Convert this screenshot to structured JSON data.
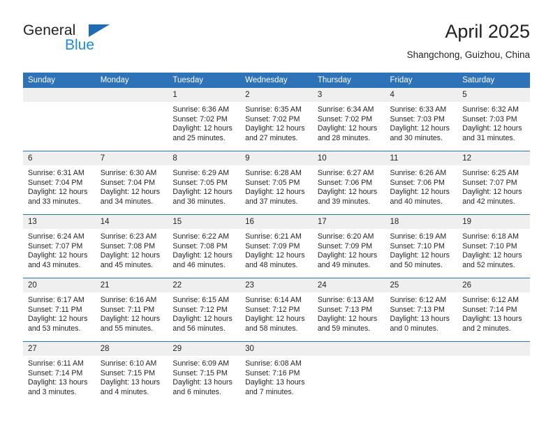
{
  "brand": {
    "name_part1": "General",
    "name_part2": "Blue",
    "accent_blue": "#1f8ad6",
    "logo_triangle_color": "#1f6cb4"
  },
  "header": {
    "title": "April 2025",
    "location": "Shangchong, Guizhou, China"
  },
  "calendar": {
    "header_color": "#2e72b8",
    "daynum_strip_color": "#efefef",
    "weekday_headers": [
      "Sunday",
      "Monday",
      "Tuesday",
      "Wednesday",
      "Thursday",
      "Friday",
      "Saturday"
    ],
    "weeks": [
      [
        {
          "day": "",
          "sunrise": "",
          "sunset": "",
          "daylight_line1": "",
          "daylight_line2": ""
        },
        {
          "day": "",
          "sunrise": "",
          "sunset": "",
          "daylight_line1": "",
          "daylight_line2": ""
        },
        {
          "day": "1",
          "sunrise": "Sunrise: 6:36 AM",
          "sunset": "Sunset: 7:02 PM",
          "daylight_line1": "Daylight: 12 hours",
          "daylight_line2": "and 25 minutes."
        },
        {
          "day": "2",
          "sunrise": "Sunrise: 6:35 AM",
          "sunset": "Sunset: 7:02 PM",
          "daylight_line1": "Daylight: 12 hours",
          "daylight_line2": "and 27 minutes."
        },
        {
          "day": "3",
          "sunrise": "Sunrise: 6:34 AM",
          "sunset": "Sunset: 7:02 PM",
          "daylight_line1": "Daylight: 12 hours",
          "daylight_line2": "and 28 minutes."
        },
        {
          "day": "4",
          "sunrise": "Sunrise: 6:33 AM",
          "sunset": "Sunset: 7:03 PM",
          "daylight_line1": "Daylight: 12 hours",
          "daylight_line2": "and 30 minutes."
        },
        {
          "day": "5",
          "sunrise": "Sunrise: 6:32 AM",
          "sunset": "Sunset: 7:03 PM",
          "daylight_line1": "Daylight: 12 hours",
          "daylight_line2": "and 31 minutes."
        }
      ],
      [
        {
          "day": "6",
          "sunrise": "Sunrise: 6:31 AM",
          "sunset": "Sunset: 7:04 PM",
          "daylight_line1": "Daylight: 12 hours",
          "daylight_line2": "and 33 minutes."
        },
        {
          "day": "7",
          "sunrise": "Sunrise: 6:30 AM",
          "sunset": "Sunset: 7:04 PM",
          "daylight_line1": "Daylight: 12 hours",
          "daylight_line2": "and 34 minutes."
        },
        {
          "day": "8",
          "sunrise": "Sunrise: 6:29 AM",
          "sunset": "Sunset: 7:05 PM",
          "daylight_line1": "Daylight: 12 hours",
          "daylight_line2": "and 36 minutes."
        },
        {
          "day": "9",
          "sunrise": "Sunrise: 6:28 AM",
          "sunset": "Sunset: 7:05 PM",
          "daylight_line1": "Daylight: 12 hours",
          "daylight_line2": "and 37 minutes."
        },
        {
          "day": "10",
          "sunrise": "Sunrise: 6:27 AM",
          "sunset": "Sunset: 7:06 PM",
          "daylight_line1": "Daylight: 12 hours",
          "daylight_line2": "and 39 minutes."
        },
        {
          "day": "11",
          "sunrise": "Sunrise: 6:26 AM",
          "sunset": "Sunset: 7:06 PM",
          "daylight_line1": "Daylight: 12 hours",
          "daylight_line2": "and 40 minutes."
        },
        {
          "day": "12",
          "sunrise": "Sunrise: 6:25 AM",
          "sunset": "Sunset: 7:07 PM",
          "daylight_line1": "Daylight: 12 hours",
          "daylight_line2": "and 42 minutes."
        }
      ],
      [
        {
          "day": "13",
          "sunrise": "Sunrise: 6:24 AM",
          "sunset": "Sunset: 7:07 PM",
          "daylight_line1": "Daylight: 12 hours",
          "daylight_line2": "and 43 minutes."
        },
        {
          "day": "14",
          "sunrise": "Sunrise: 6:23 AM",
          "sunset": "Sunset: 7:08 PM",
          "daylight_line1": "Daylight: 12 hours",
          "daylight_line2": "and 45 minutes."
        },
        {
          "day": "15",
          "sunrise": "Sunrise: 6:22 AM",
          "sunset": "Sunset: 7:08 PM",
          "daylight_line1": "Daylight: 12 hours",
          "daylight_line2": "and 46 minutes."
        },
        {
          "day": "16",
          "sunrise": "Sunrise: 6:21 AM",
          "sunset": "Sunset: 7:09 PM",
          "daylight_line1": "Daylight: 12 hours",
          "daylight_line2": "and 48 minutes."
        },
        {
          "day": "17",
          "sunrise": "Sunrise: 6:20 AM",
          "sunset": "Sunset: 7:09 PM",
          "daylight_line1": "Daylight: 12 hours",
          "daylight_line2": "and 49 minutes."
        },
        {
          "day": "18",
          "sunrise": "Sunrise: 6:19 AM",
          "sunset": "Sunset: 7:10 PM",
          "daylight_line1": "Daylight: 12 hours",
          "daylight_line2": "and 50 minutes."
        },
        {
          "day": "19",
          "sunrise": "Sunrise: 6:18 AM",
          "sunset": "Sunset: 7:10 PM",
          "daylight_line1": "Daylight: 12 hours",
          "daylight_line2": "and 52 minutes."
        }
      ],
      [
        {
          "day": "20",
          "sunrise": "Sunrise: 6:17 AM",
          "sunset": "Sunset: 7:11 PM",
          "daylight_line1": "Daylight: 12 hours",
          "daylight_line2": "and 53 minutes."
        },
        {
          "day": "21",
          "sunrise": "Sunrise: 6:16 AM",
          "sunset": "Sunset: 7:11 PM",
          "daylight_line1": "Daylight: 12 hours",
          "daylight_line2": "and 55 minutes."
        },
        {
          "day": "22",
          "sunrise": "Sunrise: 6:15 AM",
          "sunset": "Sunset: 7:12 PM",
          "daylight_line1": "Daylight: 12 hours",
          "daylight_line2": "and 56 minutes."
        },
        {
          "day": "23",
          "sunrise": "Sunrise: 6:14 AM",
          "sunset": "Sunset: 7:12 PM",
          "daylight_line1": "Daylight: 12 hours",
          "daylight_line2": "and 58 minutes."
        },
        {
          "day": "24",
          "sunrise": "Sunrise: 6:13 AM",
          "sunset": "Sunset: 7:13 PM",
          "daylight_line1": "Daylight: 12 hours",
          "daylight_line2": "and 59 minutes."
        },
        {
          "day": "25",
          "sunrise": "Sunrise: 6:12 AM",
          "sunset": "Sunset: 7:13 PM",
          "daylight_line1": "Daylight: 13 hours",
          "daylight_line2": "and 0 minutes."
        },
        {
          "day": "26",
          "sunrise": "Sunrise: 6:12 AM",
          "sunset": "Sunset: 7:14 PM",
          "daylight_line1": "Daylight: 13 hours",
          "daylight_line2": "and 2 minutes."
        }
      ],
      [
        {
          "day": "27",
          "sunrise": "Sunrise: 6:11 AM",
          "sunset": "Sunset: 7:14 PM",
          "daylight_line1": "Daylight: 13 hours",
          "daylight_line2": "and 3 minutes."
        },
        {
          "day": "28",
          "sunrise": "Sunrise: 6:10 AM",
          "sunset": "Sunset: 7:15 PM",
          "daylight_line1": "Daylight: 13 hours",
          "daylight_line2": "and 4 minutes."
        },
        {
          "day": "29",
          "sunrise": "Sunrise: 6:09 AM",
          "sunset": "Sunset: 7:15 PM",
          "daylight_line1": "Daylight: 13 hours",
          "daylight_line2": "and 6 minutes."
        },
        {
          "day": "30",
          "sunrise": "Sunrise: 6:08 AM",
          "sunset": "Sunset: 7:16 PM",
          "daylight_line1": "Daylight: 13 hours",
          "daylight_line2": "and 7 minutes."
        },
        {
          "day": "",
          "sunrise": "",
          "sunset": "",
          "daylight_line1": "",
          "daylight_line2": ""
        },
        {
          "day": "",
          "sunrise": "",
          "sunset": "",
          "daylight_line1": "",
          "daylight_line2": ""
        },
        {
          "day": "",
          "sunrise": "",
          "sunset": "",
          "daylight_line1": "",
          "daylight_line2": ""
        }
      ]
    ]
  }
}
